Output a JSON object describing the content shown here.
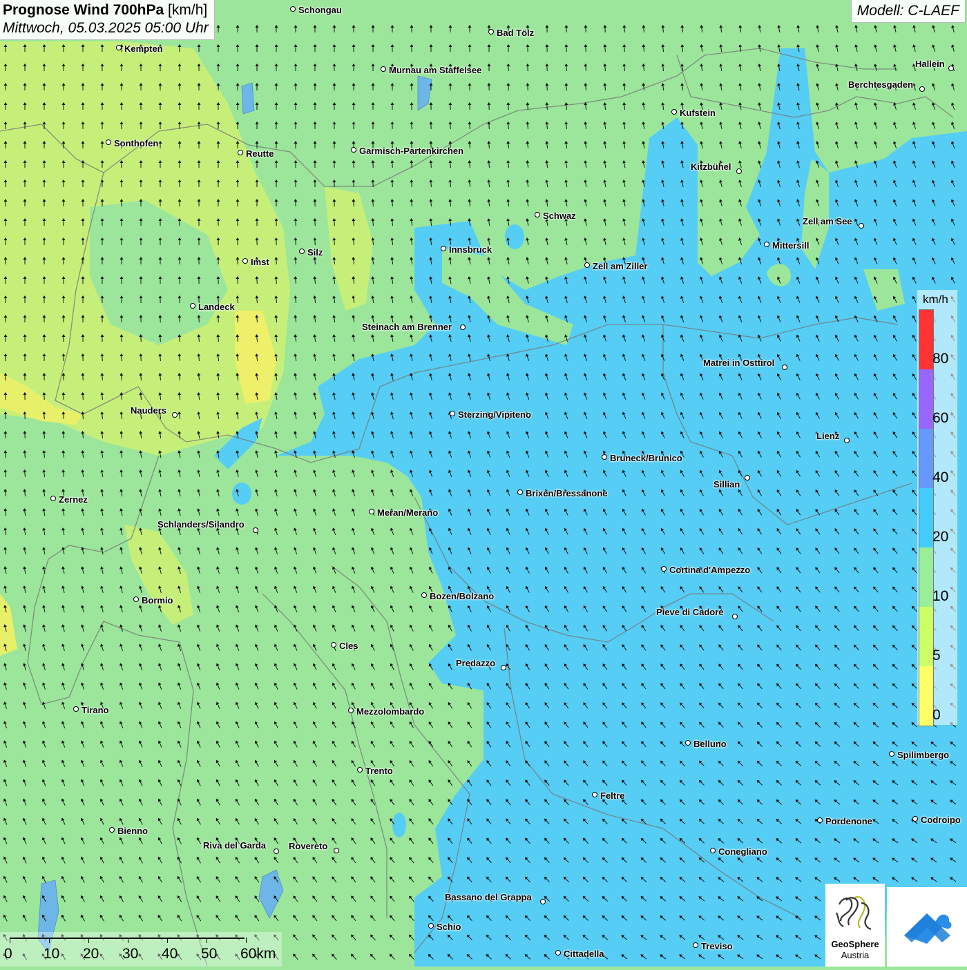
{
  "header": {
    "title_bold": "Prognose Wind 700hPa",
    "title_unit": "[km/h]",
    "subtitle": "Mittwoch, 05.03.2025 05:00 Uhr"
  },
  "model_label": "Modell: C-LAEF",
  "legend": {
    "unit": "km/h",
    "bands": [
      {
        "from": 0,
        "color": "#ffff66"
      },
      {
        "from": 5,
        "color": "#ccff66"
      },
      {
        "from": 10,
        "color": "#99ee99"
      },
      {
        "from": 20,
        "color": "#44ccff"
      },
      {
        "from": 40,
        "color": "#6699ff"
      },
      {
        "from": 60,
        "color": "#9966ff"
      },
      {
        "from": 80,
        "color": "#ff3333"
      }
    ],
    "labels": [
      "80",
      "60",
      "40",
      "20",
      "10",
      "5",
      "0"
    ]
  },
  "scale_bar": {
    "labels": [
      "0",
      "10",
      "20",
      "30",
      "40",
      "50",
      "60km"
    ]
  },
  "logos": {
    "geosphere_line1": "GeoSphere",
    "geosphere_line2": "Austria"
  },
  "cities": [
    {
      "name": "Schongau"
    },
    {
      "name": "Bad Tölz"
    },
    {
      "name": "Kempten"
    },
    {
      "name": "Hallein"
    },
    {
      "name": "Murnau am Staffelsee"
    },
    {
      "name": "Berchtesgaden"
    },
    {
      "name": "Kufstein"
    },
    {
      "name": "Sonthofen"
    },
    {
      "name": "Reutte"
    },
    {
      "name": "Garmisch-Partenkirchen"
    },
    {
      "name": "Kitzbühel"
    },
    {
      "name": "Schwaz"
    },
    {
      "name": "Zell am See"
    },
    {
      "name": "Mittersill"
    },
    {
      "name": "Innsbruck"
    },
    {
      "name": "Silz"
    },
    {
      "name": "Imst"
    },
    {
      "name": "Zell am Ziller"
    },
    {
      "name": "Landeck"
    },
    {
      "name": "Steinach am Brenner"
    },
    {
      "name": "Matrei in Osttirol"
    },
    {
      "name": "Nauders"
    },
    {
      "name": "Sterzing/Vipiteno"
    },
    {
      "name": "Lienz"
    },
    {
      "name": "Bruneck/Brunico"
    },
    {
      "name": "Sillian"
    },
    {
      "name": "Brixen/Bressanone"
    },
    {
      "name": "Zernez"
    },
    {
      "name": "Meran/Merano"
    },
    {
      "name": "Schlanders/Silandro"
    },
    {
      "name": "Cortina d'Ampezzo"
    },
    {
      "name": "Bozen/Bolzano"
    },
    {
      "name": "Bormio"
    },
    {
      "name": "Pieve di Cadore"
    },
    {
      "name": "Cles"
    },
    {
      "name": "Predazzo"
    },
    {
      "name": "Tirano"
    },
    {
      "name": "Mezzolombardo"
    },
    {
      "name": "Belluno"
    },
    {
      "name": "Spilimbergo"
    },
    {
      "name": "Trento"
    },
    {
      "name": "Feltre"
    },
    {
      "name": "Pordenone"
    },
    {
      "name": "Codroipo"
    },
    {
      "name": "Bienno"
    },
    {
      "name": "Riva del Garda"
    },
    {
      "name": "Rovereto"
    },
    {
      "name": "Conegliano"
    },
    {
      "name": "Bassano del Grappa"
    },
    {
      "name": "Schio"
    },
    {
      "name": "Treviso"
    },
    {
      "name": "Cittadella"
    }
  ]
}
